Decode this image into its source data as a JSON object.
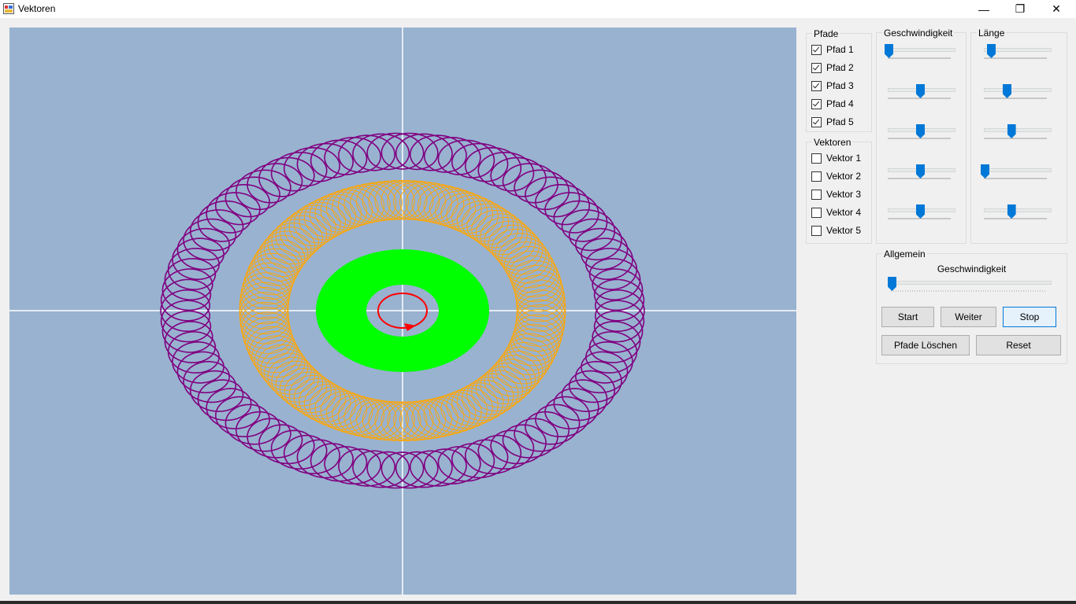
{
  "window": {
    "title": "Vektoren",
    "minimize_glyph": "—",
    "restore_glyph": "❐",
    "close_glyph": "✕"
  },
  "pfade": {
    "title": "Pfade",
    "items": [
      {
        "label": "Pfad 1",
        "checked": true
      },
      {
        "label": "Pfad 2",
        "checked": true
      },
      {
        "label": "Pfad 3",
        "checked": true
      },
      {
        "label": "Pfad 4",
        "checked": true
      },
      {
        "label": "Pfad 5",
        "checked": true
      }
    ]
  },
  "vektoren": {
    "title": "Vektoren",
    "items": [
      {
        "label": "Vektor 1",
        "checked": false
      },
      {
        "label": "Vektor 2",
        "checked": false
      },
      {
        "label": "Vektor 3",
        "checked": false
      },
      {
        "label": "Vektor 4",
        "checked": false
      },
      {
        "label": "Vektor 5",
        "checked": false
      }
    ]
  },
  "geschwindigkeit": {
    "title": "Geschwindigkeit",
    "levels": [
      0.0,
      0.5,
      0.5,
      0.5,
      0.5
    ]
  },
  "laenge": {
    "title": "Länge",
    "levels": [
      0.1,
      0.35,
      0.42,
      0.0,
      0.42
    ]
  },
  "allgemein": {
    "title": "Allgemein",
    "speed_label": "Geschwindigkeit",
    "speed_level": 0.0
  },
  "buttons": {
    "start": "Start",
    "weiter": "Weiter",
    "stop": "Stop",
    "pfade_loeschen": "Pfade Löschen",
    "reset": "Reset"
  },
  "colors": {
    "canvas": "#98b2d0",
    "axes": "#ffffff",
    "path_purple": "#800080",
    "path_orange": "#ffa500",
    "path_green": "#00ff00",
    "path_red": "#ff0000",
    "accent": "#0078d7"
  },
  "icons": {
    "app": "app-window-icon"
  }
}
